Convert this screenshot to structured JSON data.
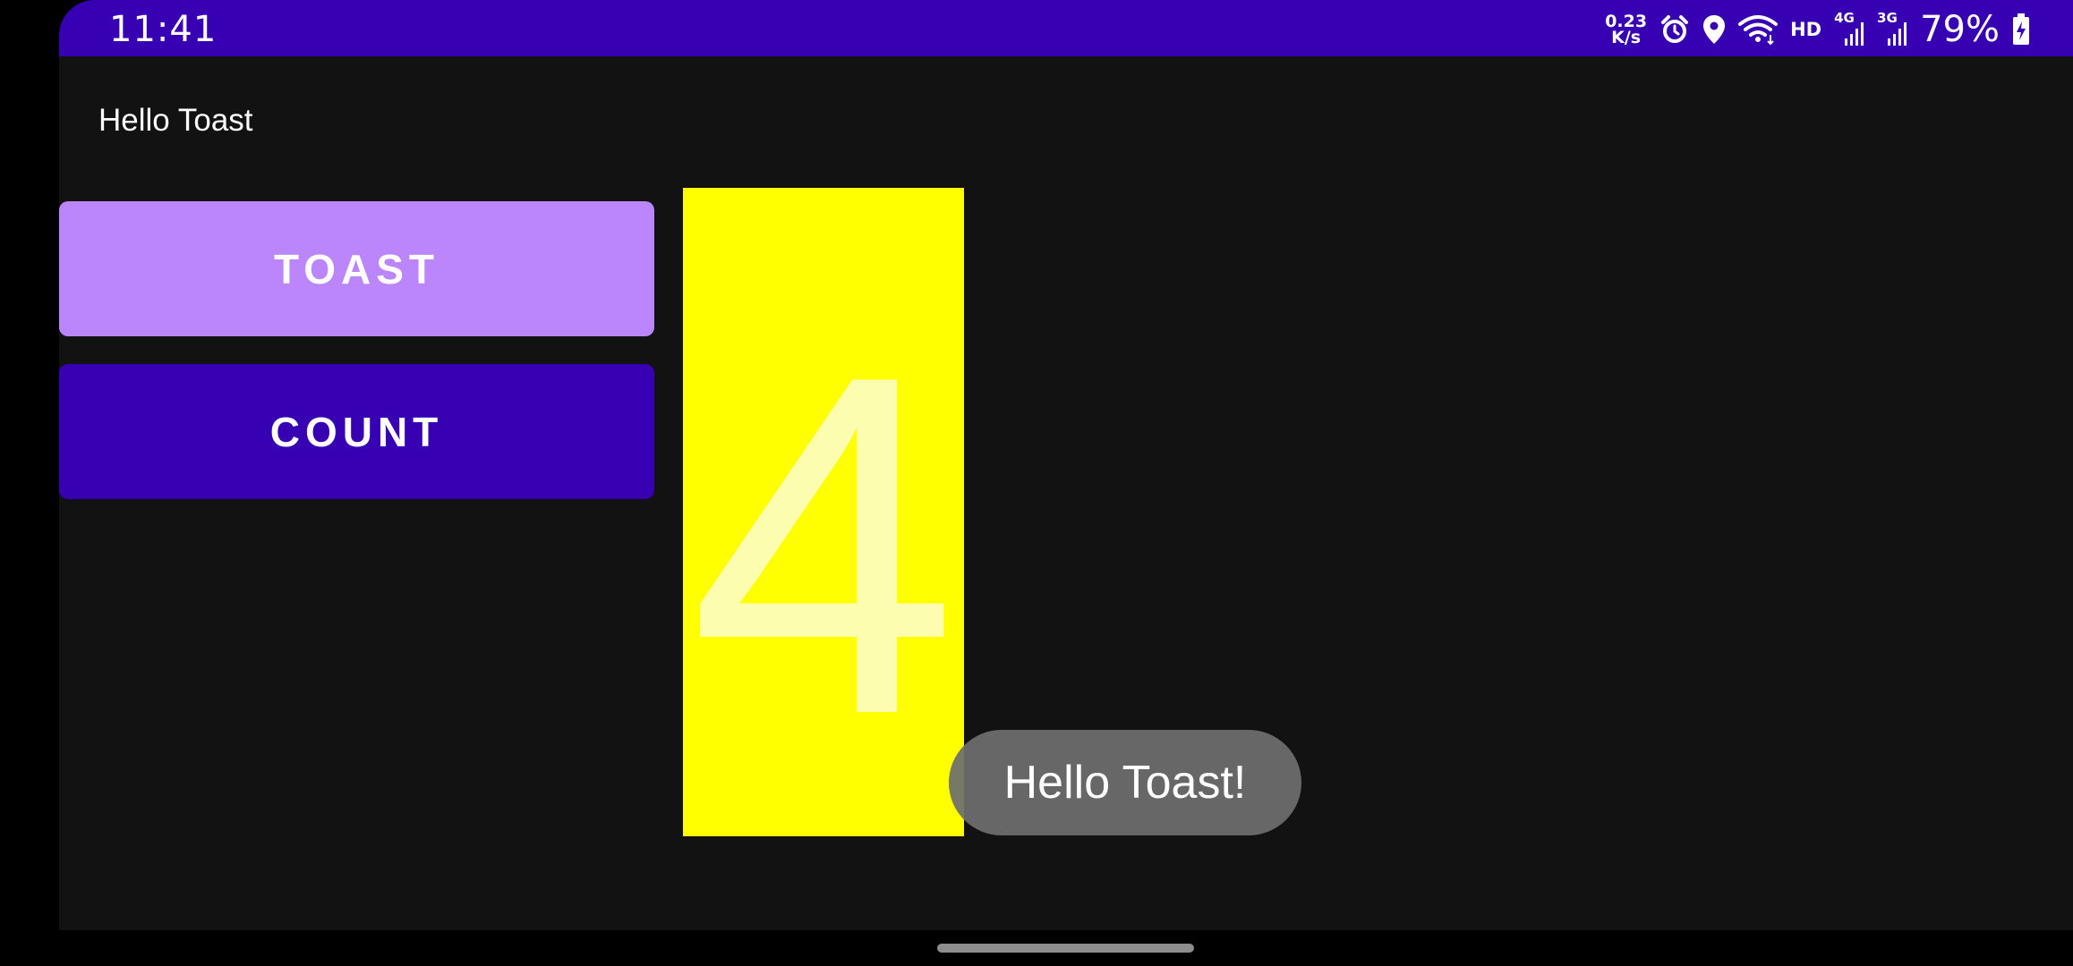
{
  "status_bar": {
    "time": "11:41",
    "net_speed_value": "0.23",
    "net_speed_unit": "K/s",
    "hd_label": "HD",
    "network_4g": "4G",
    "network_3g": "3G",
    "battery_percent": "79%",
    "icons": [
      "alarm-icon",
      "location-icon",
      "wifi-icon",
      "signal-icon",
      "signal-icon",
      "battery-charging-icon"
    ],
    "color": "#3700b3"
  },
  "app": {
    "title": "Hello Toast",
    "toast_button_label": "TOAST",
    "count_button_label": "COUNT",
    "count_value": "4",
    "toast_message": "Hello Toast!",
    "colors": {
      "background": "#121212",
      "toast_button": "#bb86fc",
      "count_button": "#3700b3",
      "count_box": "#ffff00"
    }
  }
}
